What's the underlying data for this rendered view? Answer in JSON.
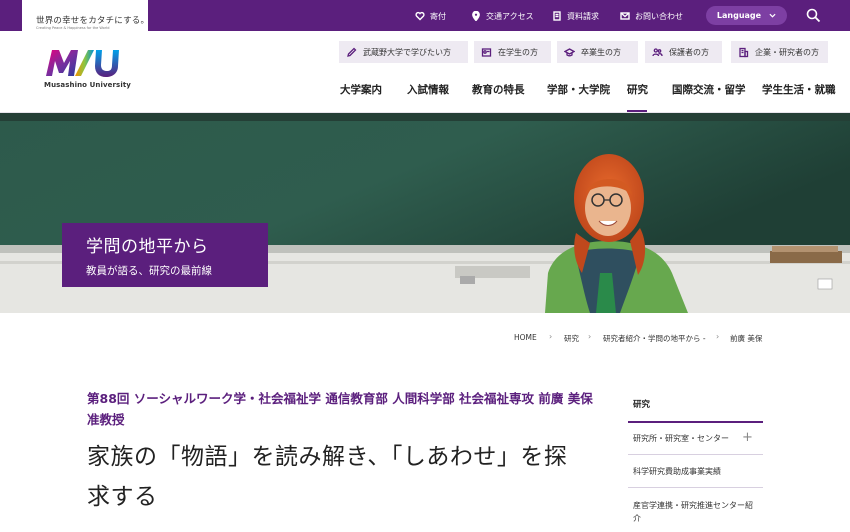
{
  "header": {
    "tagline": "世界の幸せをカタチにする。",
    "tagline_sub": "Creating Peace & Happiness for the World",
    "logo_text": "Musashino University",
    "utility": [
      {
        "label": "寄付",
        "icon": "heart-hand-icon"
      },
      {
        "label": "交通アクセス",
        "icon": "map-pin-icon"
      },
      {
        "label": "資料請求",
        "icon": "document-icon"
      },
      {
        "label": "お問い合わせ",
        "icon": "mail-icon"
      }
    ],
    "language_label": "Language",
    "audience": [
      {
        "label": "武蔵野大学で学びたい方",
        "icon": "pencil-icon"
      },
      {
        "label": "在学生の方",
        "icon": "student-icon"
      },
      {
        "label": "卒業生の方",
        "icon": "graduation-cap-icon"
      },
      {
        "label": "保護者の方",
        "icon": "people-icon"
      },
      {
        "label": "企業・研究者の方",
        "icon": "building-icon"
      }
    ],
    "nav": [
      "大学案内",
      "入試情報",
      "教育の特長",
      "学部・大学院",
      "研究",
      "国際交流・留学",
      "学生生活・就職"
    ],
    "nav_active": "研究"
  },
  "hero": {
    "title": "学問の地平から",
    "subtitle": "教員が語る、研究の最前線"
  },
  "breadcrumb": [
    "HOME",
    "研究",
    "研究者紹介・学問の地平から -",
    "前廣 美保"
  ],
  "article": {
    "subtitle": "第88回 ソーシャルワーク学・社会福祉学 通信教育部 人間科学部 社会福祉専攻 前廣 美保 准教授",
    "title": "家族の「物語」を読み解き、「しあわせ」を探求する"
  },
  "sidebar": {
    "heading": "研究",
    "items": [
      "研究所・研究室・センター",
      "科学研究費助成事業実績",
      "産官学連携・研究推進センター紹介"
    ]
  },
  "colors": {
    "brand_purple": "#5b1f7d",
    "chalkboard": "#2c5447"
  }
}
